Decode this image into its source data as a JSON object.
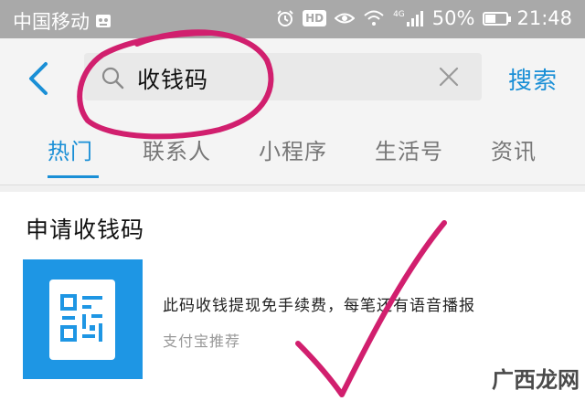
{
  "status_bar": {
    "carrier": "中国移动",
    "signal_label": "4G",
    "battery": "50%",
    "battery_level": 0.5,
    "time": "21:48",
    "hd_label": "HD"
  },
  "search": {
    "query": "收钱码",
    "submit_label": "搜索"
  },
  "tabs": [
    {
      "label": "热门",
      "active": true
    },
    {
      "label": "联系人",
      "active": false
    },
    {
      "label": "小程序",
      "active": false
    },
    {
      "label": "生活号",
      "active": false
    },
    {
      "label": "资讯",
      "active": false
    }
  ],
  "result": {
    "title": "申请收钱码",
    "description": "此码收钱提现免手续费，每笔还有语音播报",
    "source": "支付宝推荐"
  },
  "watermark": "广西龙网",
  "colors": {
    "accent": "#1a8fd6",
    "status_bar": "#a9a9a9",
    "annotation": "#d11f6e",
    "thumb_bg": "#1e96e4"
  },
  "icons": {
    "back": "chevron-left-icon",
    "search": "search-icon",
    "clear": "close-icon",
    "qr": "qr-code-icon"
  }
}
